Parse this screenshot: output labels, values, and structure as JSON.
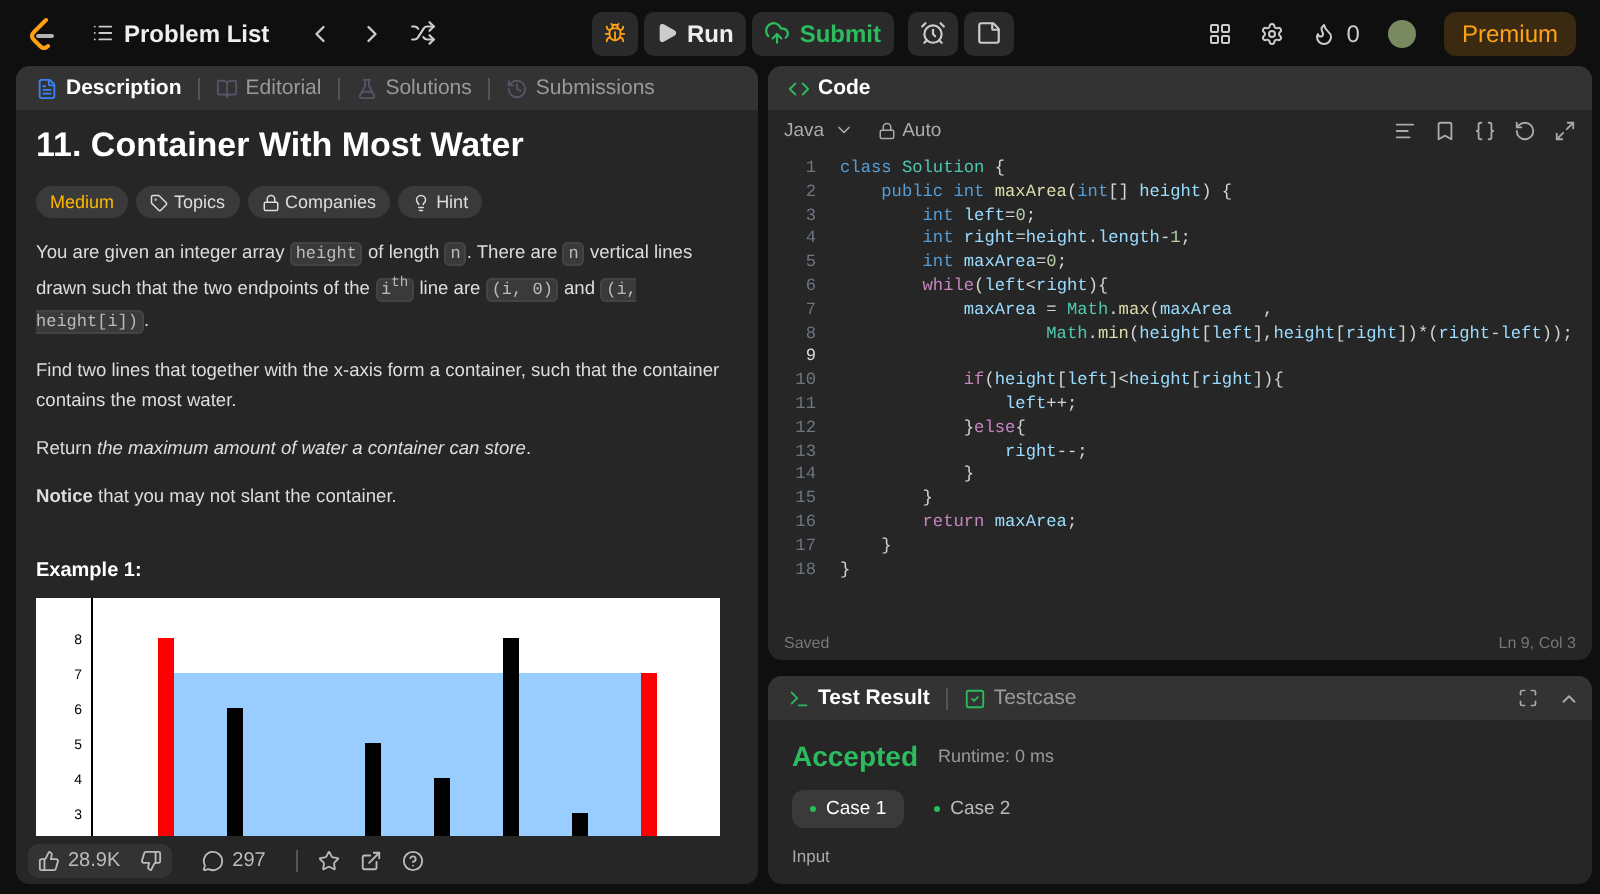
{
  "topbar": {
    "problem_list": "Problem List",
    "run": "Run",
    "submit": "Submit",
    "streak": "0",
    "premium": "Premium"
  },
  "description_tabs": [
    {
      "label": "Description",
      "selected": true
    },
    {
      "label": "Editorial",
      "selected": false
    },
    {
      "label": "Solutions",
      "selected": false
    },
    {
      "label": "Submissions",
      "selected": false
    }
  ],
  "problem": {
    "title": "11. Container With Most Water",
    "difficulty": "Medium",
    "tags": [
      "Topics",
      "Companies",
      "Hint"
    ],
    "paragraphs": [
      [
        {
          "kind": "text",
          "text": "You are given an integer array "
        },
        {
          "kind": "code",
          "text": "height"
        },
        {
          "kind": "text",
          "text": " of length "
        },
        {
          "kind": "code",
          "text": "n"
        },
        {
          "kind": "text",
          "text": ". There are "
        },
        {
          "kind": "code",
          "text": "n"
        },
        {
          "kind": "text",
          "text": " vertical lines drawn such that the two endpoints of the "
        },
        {
          "kind": "code",
          "text": "i$^{th}$"
        },
        {
          "kind": "text",
          "text": " line are "
        },
        {
          "kind": "code",
          "text": "(i, 0)"
        },
        {
          "kind": "text",
          "text": " and "
        },
        {
          "kind": "code",
          "text": "(i, height[i])"
        },
        {
          "kind": "text",
          "text": "."
        }
      ],
      [
        {
          "kind": "text",
          "text": "Find two lines that together with the x-axis form a container, such that the container contains the most water."
        }
      ],
      [
        {
          "kind": "text",
          "text": "Return *the maximum amount of water a container can store*."
        }
      ],
      [
        {
          "kind": "text",
          "text": "**Notice** that you may not slant the container."
        }
      ]
    ],
    "example_title": "Example 1:",
    "figure": {
      "axis_labels": [
        "8",
        "7",
        "6",
        "5",
        "4",
        "3"
      ]
    }
  },
  "footer": {
    "likes": "28.9K",
    "comments": "297"
  },
  "code_panel": {
    "title": "Code",
    "language": "Java",
    "mode": "Auto",
    "saved": "Saved",
    "cursor": "Ln 9, Col 3",
    "lines": [
      {
        "number": "1",
        "tokens": [
          {
            "kind": "keyword",
            "text": "class "
          },
          {
            "kind": "type",
            "text": "Solution"
          },
          {
            "kind": "plain",
            "text": " {"
          }
        ]
      },
      {
        "number": "2",
        "tokens": [
          {
            "kind": "keyword",
            "text": "    public int "
          },
          {
            "kind": "func",
            "text": "maxArea"
          },
          {
            "kind": "plain",
            "text": "("
          },
          {
            "kind": "keyword",
            "text": "int"
          },
          {
            "kind": "plain",
            "text": "[] "
          },
          {
            "kind": "ident",
            "text": "height"
          },
          {
            "kind": "plain",
            "text": ") {"
          }
        ]
      },
      {
        "number": "3",
        "tokens": [
          {
            "kind": "keyword",
            "text": "        int "
          },
          {
            "kind": "ident",
            "text": "left"
          },
          {
            "kind": "plain",
            "text": "="
          },
          {
            "kind": "number",
            "text": "0"
          },
          {
            "kind": "plain",
            "text": ";"
          }
        ]
      },
      {
        "number": "4",
        "tokens": [
          {
            "kind": "keyword",
            "text": "        int "
          },
          {
            "kind": "ident",
            "text": "right"
          },
          {
            "kind": "plain",
            "text": "="
          },
          {
            "kind": "ident",
            "text": "height"
          },
          {
            "kind": "plain",
            "text": "."
          },
          {
            "kind": "ident",
            "text": "length"
          },
          {
            "kind": "plain",
            "text": "-"
          },
          {
            "kind": "number",
            "text": "1"
          },
          {
            "kind": "plain",
            "text": ";"
          }
        ]
      },
      {
        "number": "5",
        "tokens": [
          {
            "kind": "keyword",
            "text": "        int "
          },
          {
            "kind": "ident",
            "text": "maxArea"
          },
          {
            "kind": "plain",
            "text": "="
          },
          {
            "kind": "number",
            "text": "0"
          },
          {
            "kind": "plain",
            "text": ";"
          }
        ]
      },
      {
        "number": "6",
        "tokens": [
          {
            "kind": "control",
            "text": "        while"
          },
          {
            "kind": "plain",
            "text": "("
          },
          {
            "kind": "ident",
            "text": "left"
          },
          {
            "kind": "plain",
            "text": "<"
          },
          {
            "kind": "ident",
            "text": "right"
          },
          {
            "kind": "plain",
            "text": "){"
          }
        ]
      },
      {
        "number": "7",
        "tokens": [
          {
            "kind": "ident",
            "text": "            maxArea"
          },
          {
            "kind": "plain",
            "text": " = "
          },
          {
            "kind": "type",
            "text": "Math"
          },
          {
            "kind": "plain",
            "text": "."
          },
          {
            "kind": "func",
            "text": "max"
          },
          {
            "kind": "plain",
            "text": "("
          },
          {
            "kind": "ident",
            "text": "maxArea"
          },
          {
            "kind": "plain",
            "text": "   ,"
          }
        ]
      },
      {
        "number": "8",
        "tokens": [
          {
            "kind": "type",
            "text": "                    Math"
          },
          {
            "kind": "plain",
            "text": "."
          },
          {
            "kind": "func",
            "text": "min"
          },
          {
            "kind": "plain",
            "text": "("
          },
          {
            "kind": "ident",
            "text": "height"
          },
          {
            "kind": "plain",
            "text": "["
          },
          {
            "kind": "ident",
            "text": "left"
          },
          {
            "kind": "plain",
            "text": "],"
          },
          {
            "kind": "ident",
            "text": "height"
          },
          {
            "kind": "plain",
            "text": "["
          },
          {
            "kind": "ident",
            "text": "right"
          },
          {
            "kind": "plain",
            "text": "])*("
          },
          {
            "kind": "ident",
            "text": "right"
          },
          {
            "kind": "plain",
            "text": "-"
          },
          {
            "kind": "ident",
            "text": "left"
          },
          {
            "kind": "plain",
            "text": "));"
          }
        ]
      },
      {
        "number": "9"
      },
      {
        "number": "10",
        "tokens": [
          {
            "kind": "control",
            "text": "            if"
          },
          {
            "kind": "plain",
            "text": "("
          },
          {
            "kind": "ident",
            "text": "height"
          },
          {
            "kind": "plain",
            "text": "["
          },
          {
            "kind": "ident",
            "text": "left"
          },
          {
            "kind": "plain",
            "text": "]<"
          },
          {
            "kind": "ident",
            "text": "height"
          },
          {
            "kind": "plain",
            "text": "["
          },
          {
            "kind": "ident",
            "text": "right"
          },
          {
            "kind": "plain",
            "text": "]){"
          }
        ]
      },
      {
        "number": "11",
        "tokens": [
          {
            "kind": "ident",
            "text": "                left"
          },
          {
            "kind": "plain",
            "text": "++;"
          }
        ]
      },
      {
        "number": "12",
        "tokens": [
          {
            "kind": "plain",
            "text": "            }"
          },
          {
            "kind": "control",
            "text": "else"
          },
          {
            "kind": "plain",
            "text": "{"
          }
        ]
      },
      {
        "number": "13",
        "tokens": [
          {
            "kind": "ident",
            "text": "                right"
          },
          {
            "kind": "plain",
            "text": "--;"
          }
        ]
      },
      {
        "number": "14",
        "tokens": [
          {
            "kind": "plain",
            "text": "            }"
          }
        ]
      },
      {
        "number": "15",
        "tokens": [
          {
            "kind": "plain",
            "text": "        }"
          }
        ]
      },
      {
        "number": "16",
        "tokens": [
          {
            "kind": "control",
            "text": "        return "
          },
          {
            "kind": "ident",
            "text": "maxArea"
          },
          {
            "kind": "plain",
            "text": ";"
          }
        ]
      },
      {
        "number": "17",
        "tokens": [
          {
            "kind": "plain",
            "text": "    }"
          }
        ]
      },
      {
        "number": "18",
        "tokens": [
          {
            "kind": "plain",
            "text": "}"
          }
        ]
      }
    ]
  },
  "result_tabs": [
    {
      "label": "Test Result",
      "selected": true
    },
    {
      "label": "Testcase",
      "selected": false
    }
  ],
  "result": {
    "status": "Accepted",
    "runtime": "Runtime: 0 ms",
    "cases": [
      {
        "label": "Case 1",
        "selected": true
      },
      {
        "label": "Case 2",
        "selected": false
      }
    ],
    "input_label": "Input"
  }
}
